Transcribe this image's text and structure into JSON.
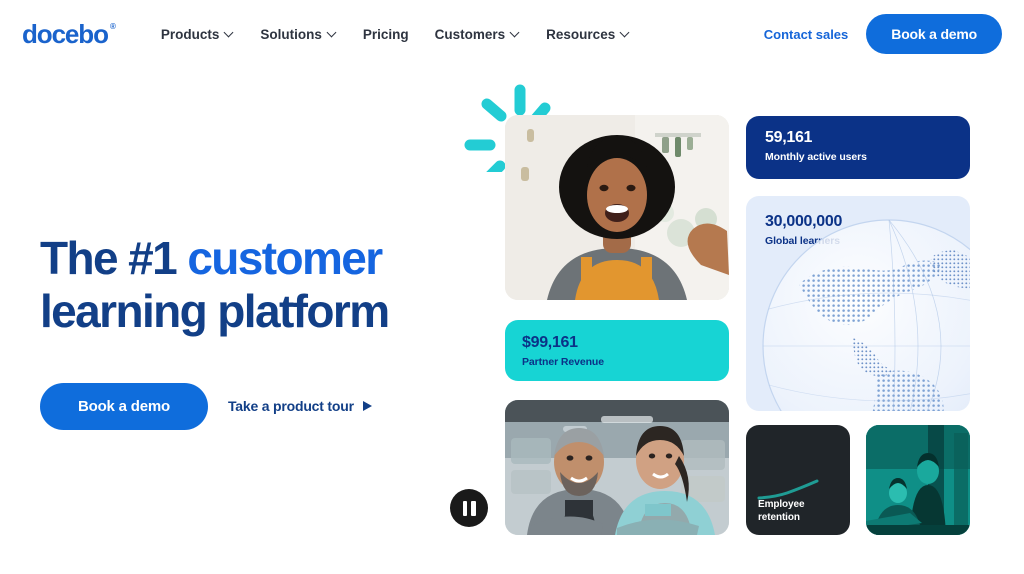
{
  "brand": {
    "logo_text": "docebo",
    "logo_mark": "®",
    "logo_color": "#1a63cc"
  },
  "nav": {
    "items": [
      {
        "label": "Products",
        "has_dropdown": true,
        "icon": "chevron-down-icon"
      },
      {
        "label": "Solutions",
        "has_dropdown": true,
        "icon": "chevron-down-icon"
      },
      {
        "label": "Pricing",
        "has_dropdown": false,
        "icon": ""
      },
      {
        "label": "Customers",
        "has_dropdown": true,
        "icon": "chevron-down-icon"
      },
      {
        "label": "Resources",
        "has_dropdown": true,
        "icon": "chevron-down-icon"
      }
    ],
    "contact_sales": "Contact sales",
    "demo_button": "Book a demo"
  },
  "hero": {
    "headline_part1": "The #1 ",
    "headline_accent": "customer",
    "headline_part2": "learning platform",
    "primary_cta": "Book a demo",
    "secondary_cta": "Take a product tour",
    "secondary_cta_icon": "play-triangle-icon",
    "colors": {
      "navy": "#123f87",
      "accent_blue": "#1565e0",
      "button_blue": "#0f6ddc"
    }
  },
  "carousel": {
    "pause_button_label": "Pause",
    "pause_icon": "pause-icon"
  },
  "decor": {
    "sparkle_icon": "sparkle-burst-icon",
    "sparkle_color": "#23ccd4"
  },
  "stats": [
    {
      "id": "monthly-active-users",
      "value": "59,161",
      "label": "Monthly active users",
      "background": "#0b3287",
      "text_color": "#ffffff"
    },
    {
      "id": "global-learners",
      "value": "30,000,000",
      "label": "Global learners",
      "background": "#e3ecfa",
      "text_color": "#0b3287",
      "graphic": "dotted-globe-icon"
    },
    {
      "id": "partner-revenue",
      "value": "$99,161",
      "label": "Partner Revenue",
      "background": "#17d4d4",
      "text_color": "#0b3287"
    }
  ],
  "tiles": {
    "retention": {
      "label_line1": "Employee",
      "label_line2": "retention",
      "background": "#202529",
      "spark_color": "#1f9c94",
      "graphic": "trend-up-line-icon"
    },
    "photo_hero": {
      "alt": "Smiling woman with afro in a plant-filled workshop",
      "name": "hero-photo"
    },
    "photo_retail": {
      "alt": "Two retail workers in aprons with arms crossed",
      "name": "retail-team-photo"
    },
    "photo_teal": {
      "alt": "Teal duotone photo of colleagues at a desk",
      "name": "teal-duotone-photo"
    }
  }
}
